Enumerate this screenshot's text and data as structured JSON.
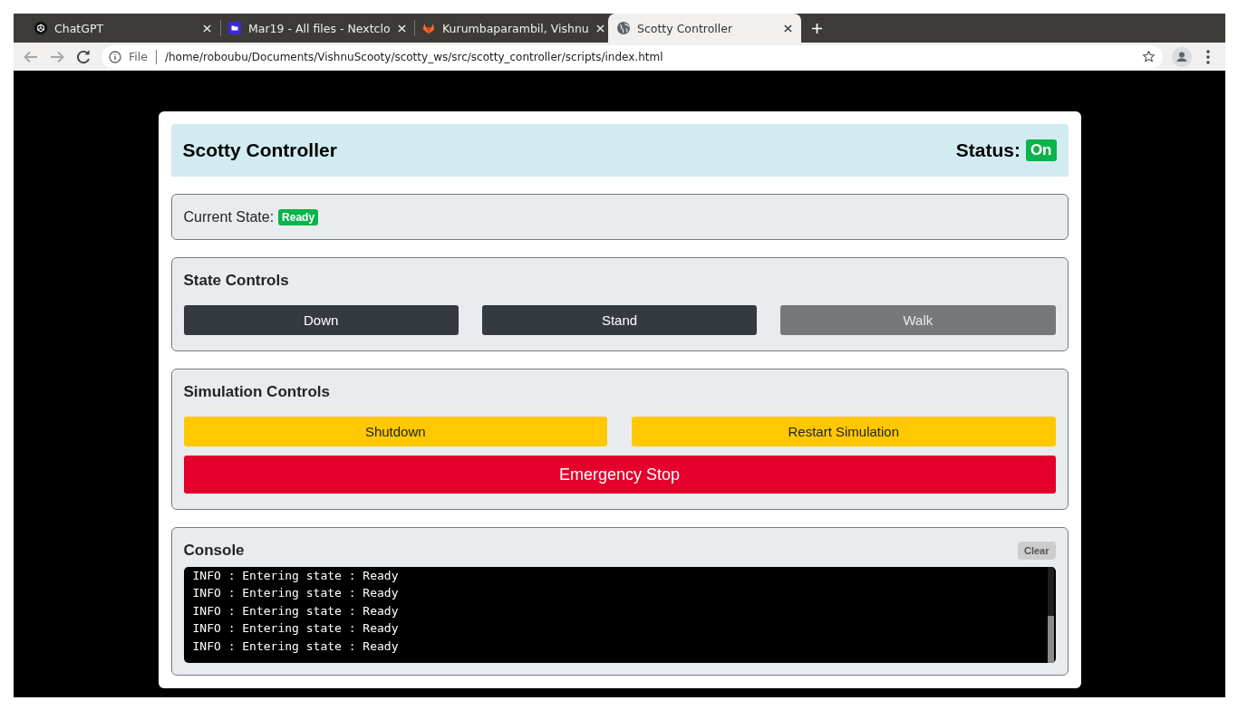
{
  "browser": {
    "tabs": [
      {
        "title": "ChatGPT",
        "selected": false
      },
      {
        "title": "Mar19 - All files - Nextclo",
        "selected": false
      },
      {
        "title": "Kurumbaparambil, Vishnu",
        "selected": false
      },
      {
        "title": "Scotty Controller",
        "selected": true
      }
    ],
    "address_bar": {
      "scheme": "File",
      "url": "/home/roboubu/Documents/VishnuScooty/scotty_ws/src/scotty_controller/scripts/index.html"
    }
  },
  "header": {
    "title": "Scotty Controller",
    "status_label": "Status:",
    "status": {
      "text": "On",
      "on": true
    }
  },
  "current_state": {
    "label": "Current State:",
    "badge": "Ready"
  },
  "state_controls": {
    "title": "State Controls",
    "buttons": [
      {
        "label": "Down",
        "disabled": false
      },
      {
        "label": "Stand",
        "disabled": false
      },
      {
        "label": "Walk",
        "disabled": true
      }
    ]
  },
  "simulation_controls": {
    "title": "Simulation Controls",
    "buttons": [
      {
        "label": "Shutdown",
        "kind": "warning"
      },
      {
        "label": "Restart Simulation",
        "kind": "warning"
      },
      {
        "label": "Emergency Stop",
        "kind": "danger"
      }
    ]
  },
  "console": {
    "title": "Console",
    "clear_button": "Clear",
    "lines": [
      "INFO : Entering state : Ready",
      "INFO : Entering state : Ready",
      "INFO : Entering state : Ready",
      "INFO : Entering state : Ready",
      "INFO : Entering state : Ready"
    ]
  }
}
